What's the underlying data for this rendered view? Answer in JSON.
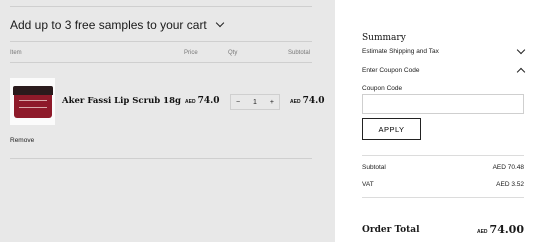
{
  "cart": {
    "samples_label": "Add up to 3 free samples to your cart",
    "headers": {
      "item": "Item",
      "price": "Price",
      "qty": "Qty",
      "subtotal": "Subtotal"
    },
    "item": {
      "name": "Aker Fassi Lip Scrub 18g",
      "currency": "AED",
      "price": "74.0",
      "qty": "1",
      "subtotal": "74.0",
      "minus": "−",
      "plus": "+",
      "remove_label": "Remove"
    }
  },
  "summary": {
    "title": "Summary",
    "shipping_label": "Estimate Shipping and Tax",
    "coupon_toggle": "Enter Coupon Code",
    "coupon_label": "Coupon Code",
    "coupon_placeholder": "",
    "apply_label": "APPLY",
    "subtotal_label": "Subtotal",
    "subtotal_value": "AED 70.48",
    "vat_label": "VAT",
    "vat_value": "AED 3.52",
    "order_total_label": "Order Total",
    "order_total_currency": "AED",
    "order_total_value": "74.00"
  },
  "colors": {
    "page_bg": "#e8e8e8",
    "panel_bg": "#ffffff",
    "product_red": "#8e1a2a"
  },
  "icons": [
    "chevron-down-icon",
    "chevron-up-icon"
  ]
}
